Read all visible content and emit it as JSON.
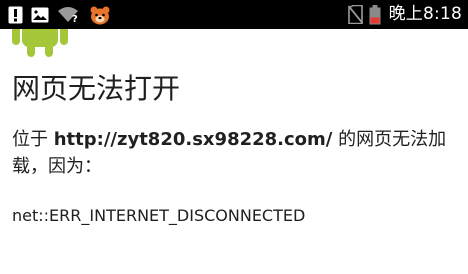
{
  "status_bar": {
    "left_icons": [
      "alert-icon",
      "gallery-icon",
      "wifi-question-icon",
      "bear-app-icon"
    ],
    "right_icons": [
      "no-sim-icon",
      "battery-icon"
    ],
    "time": "晚上8:18"
  },
  "error_page": {
    "logo": "android-logo",
    "title": "网页无法打开",
    "message_prefix": "位于 ",
    "url": "http://zyt820.sx98228.com/",
    "message_suffix": " 的网页无法加载，因为：",
    "error_code": "net::ERR_INTERNET_DISCONNECTED"
  },
  "colors": {
    "status_bar_bg": "#000000",
    "android_green": "#a4c639",
    "text": "#202020",
    "bear_orange": "#e8742a"
  }
}
